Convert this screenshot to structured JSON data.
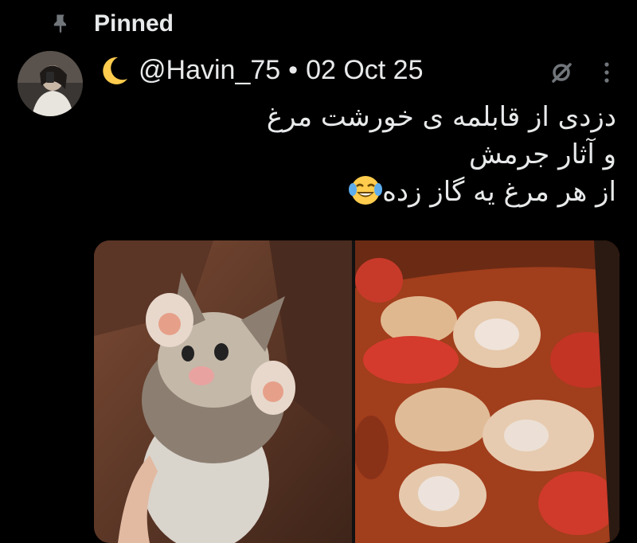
{
  "pinned": {
    "label": "Pinned",
    "icon": "pin-icon"
  },
  "post": {
    "emoji_prefix": "moon-icon",
    "handle": "@Havin_75",
    "separator": "•",
    "date": "02 Oct 25",
    "text_lines": [
      "دزدی از قابلمه ی خورشت مرغ",
      "و آثار جرمش",
      "از هر مرغ یه گاز زده"
    ],
    "text_emoji": "tears-of-joy-emoji",
    "actions": {
      "muted_icon": "muted-circle-icon",
      "more_icon": "more-vertical-icon"
    },
    "media": [
      {
        "description_icon": "kitten-photo"
      },
      {
        "description_icon": "chicken-stew-photo"
      }
    ]
  },
  "colors": {
    "background": "#000000",
    "text": "#e7e9ea",
    "secondary": "#71767b",
    "moon": "#ffcc4d"
  }
}
